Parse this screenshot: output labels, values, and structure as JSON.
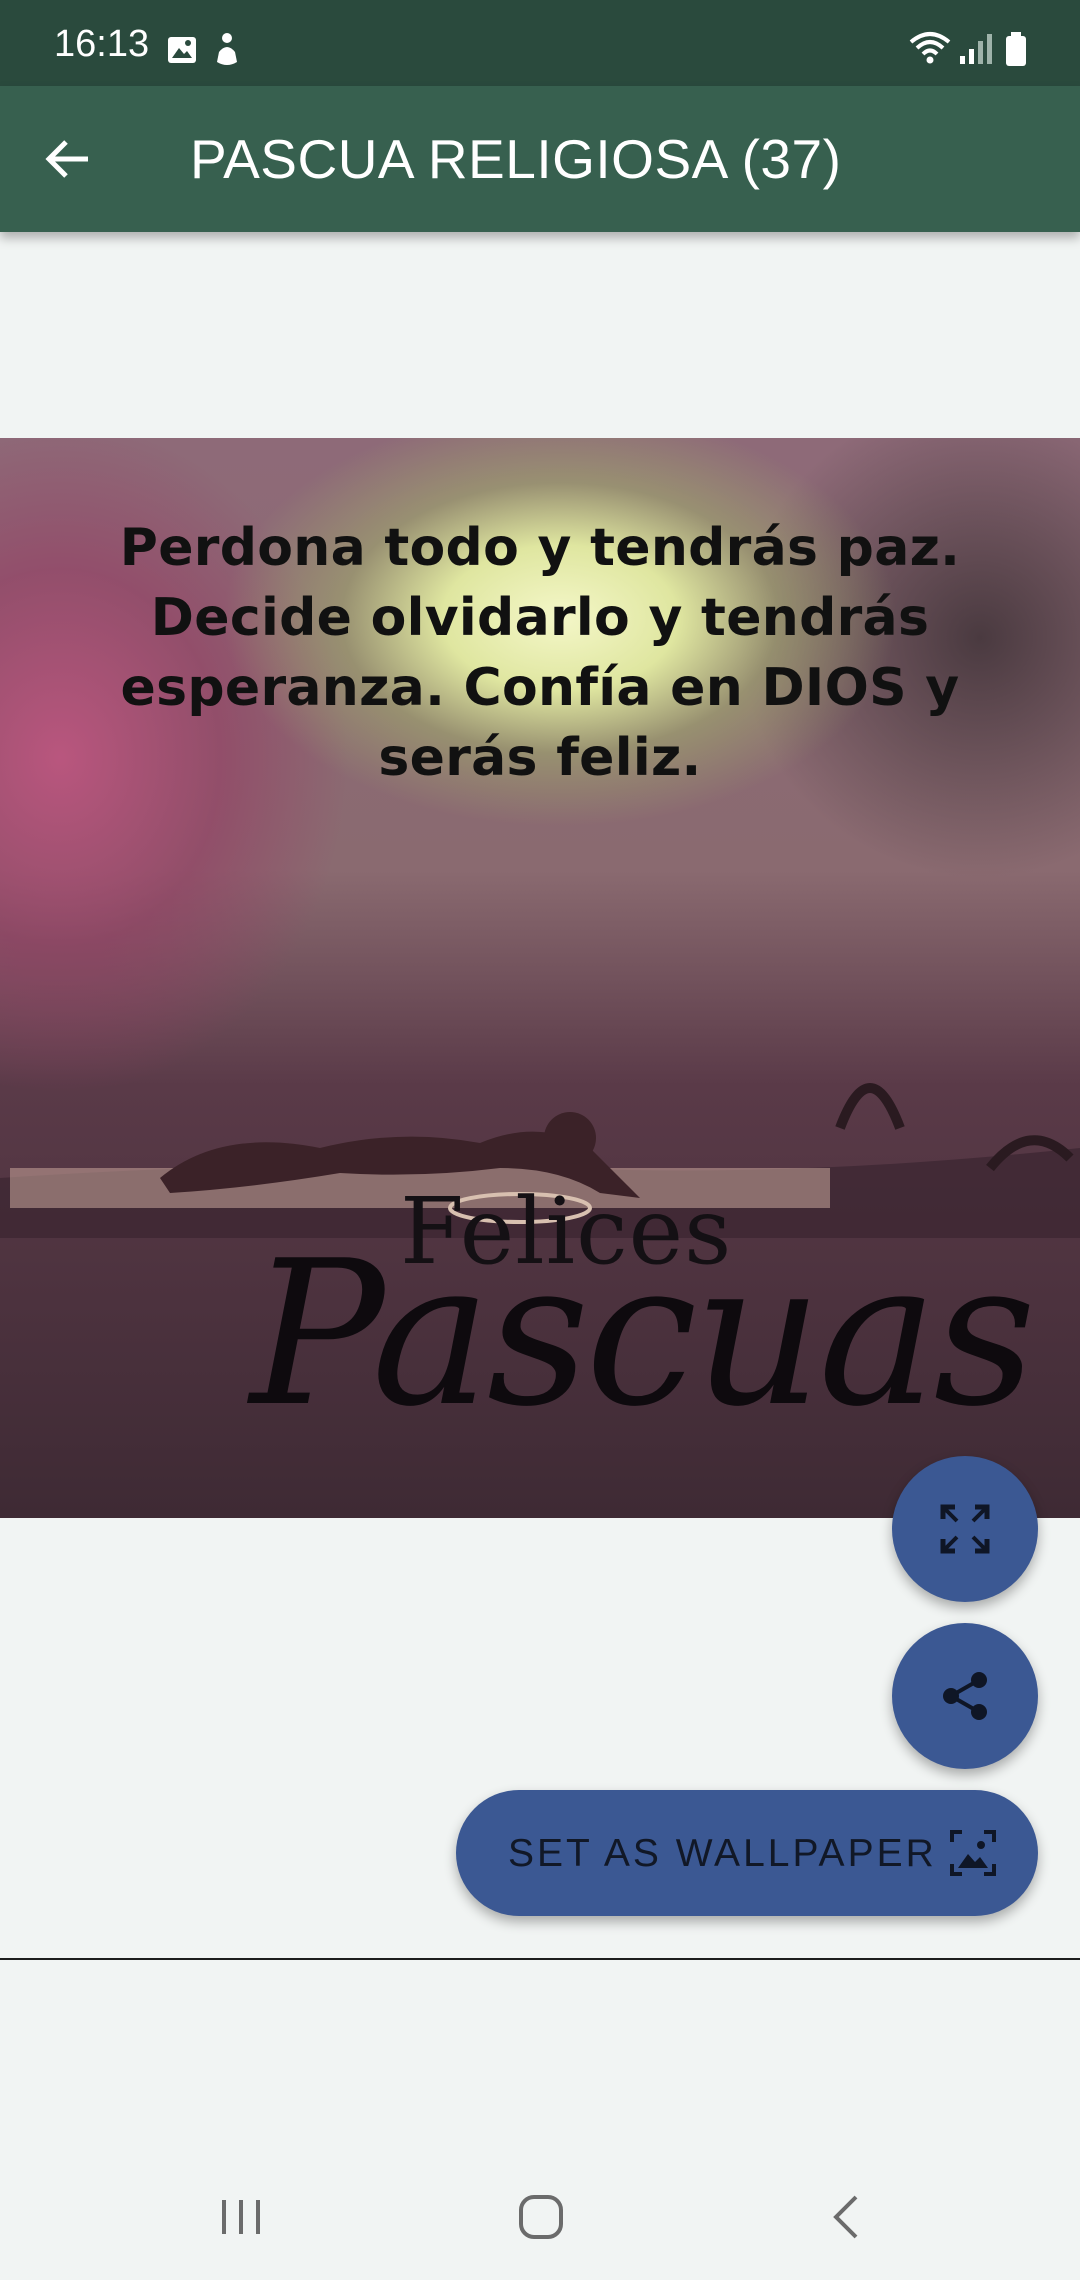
{
  "status_bar": {
    "time": "16:13",
    "icons": [
      "image-icon",
      "accessibility-icon",
      "wifi-icon",
      "signal-icon",
      "battery-icon"
    ]
  },
  "app_bar": {
    "title": "PASCUA RELIGIOSA (37)",
    "back_icon": "arrow-back-icon",
    "background_color": "#37604f",
    "status_color": "#2a4a3d"
  },
  "image": {
    "quote_lines": [
      "Perdona todo y tendrás paz.",
      "Decide olvidarlo y tendrás",
      "esperanza. Confía en DIOS y",
      "serás feliz."
    ],
    "greeting_top": "Felices",
    "greeting_bottom": "Pascuas"
  },
  "actions": {
    "fullscreen_icon": "fullscreen-icon",
    "share_icon": "share-icon",
    "wallpaper_label": "SET AS WALLPAPER",
    "wallpaper_icon": "wallpaper-icon",
    "accent_color": "#3b5893"
  },
  "nav_bar": {
    "icons": [
      "recents-icon",
      "home-icon",
      "back-icon"
    ]
  }
}
